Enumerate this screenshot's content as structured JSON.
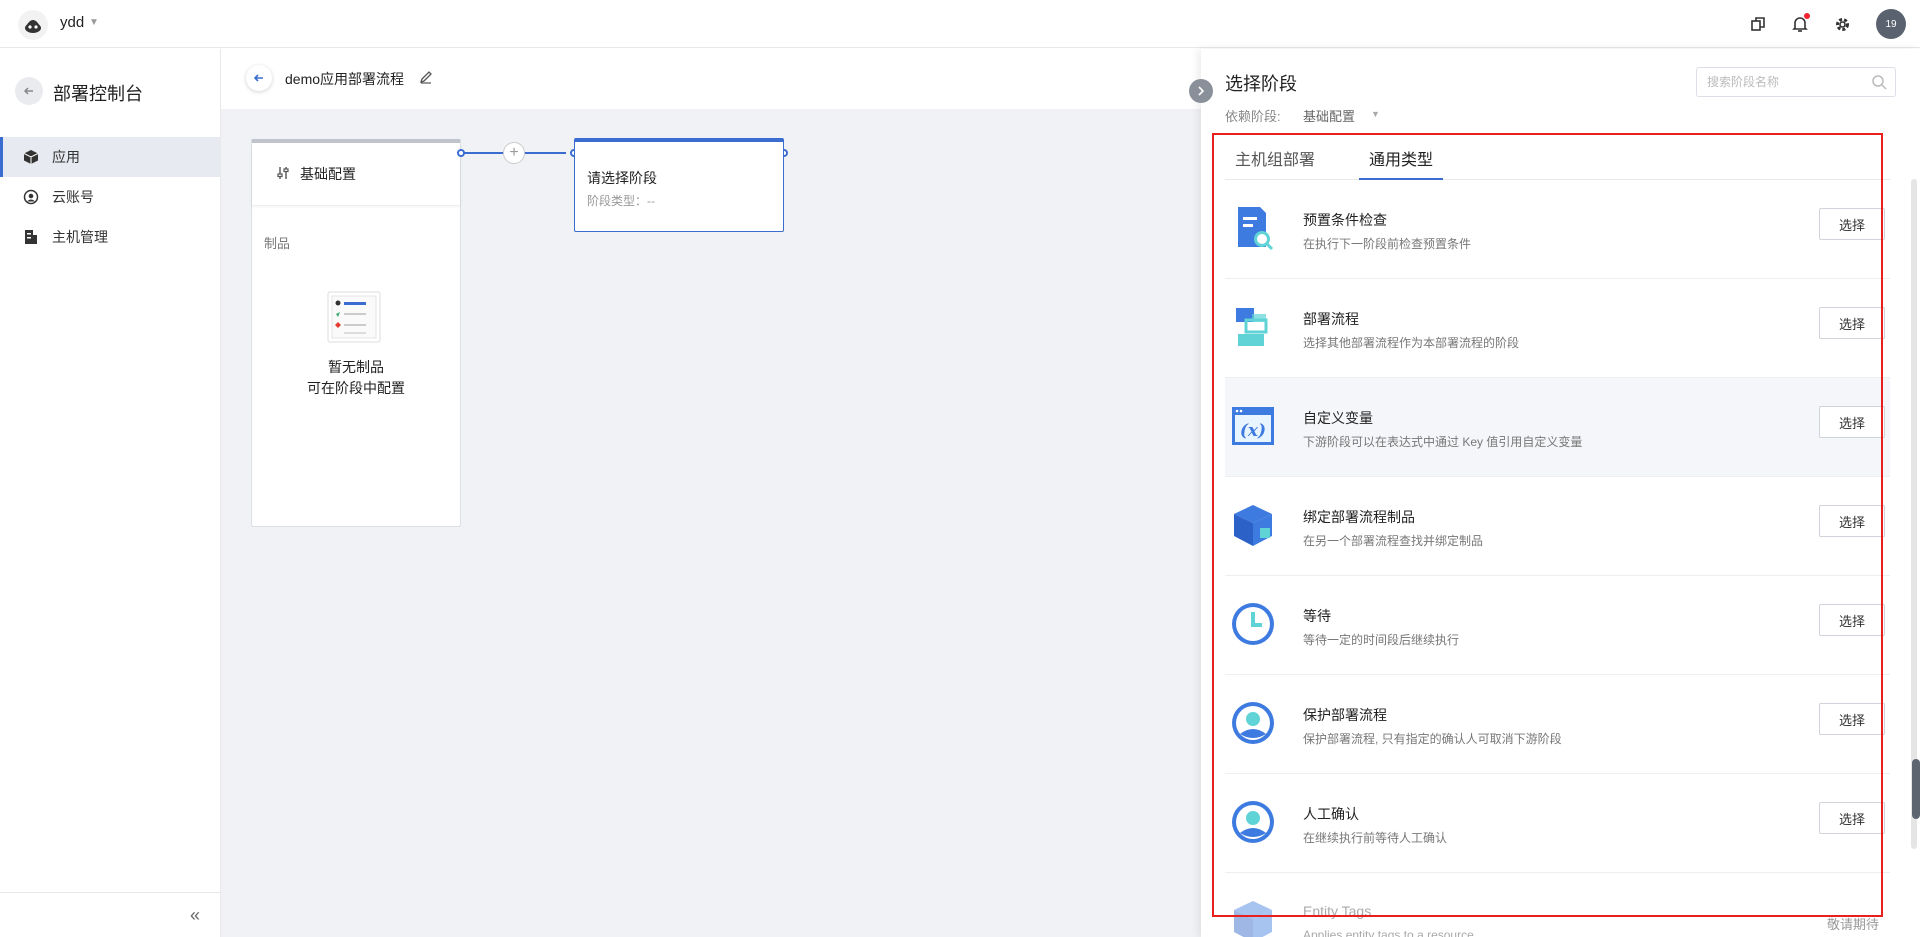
{
  "topbar": {
    "org_name": "ydd",
    "avatar_text": "19"
  },
  "sidebar": {
    "title": "部署控制台",
    "items": [
      {
        "label": "应用",
        "active": true
      },
      {
        "label": "云账号",
        "active": false
      },
      {
        "label": "主机管理",
        "active": false
      }
    ],
    "collapse_glyph": "«"
  },
  "pipeline": {
    "title": "demo应用部署流程",
    "stage": {
      "title": "基础配置",
      "section_label": "制品",
      "empty_line1": "暂无制品",
      "empty_line2": "可在阶段中配置"
    },
    "new_stage": {
      "title": "请选择阶段",
      "type_label": "阶段类型：--"
    }
  },
  "drawer": {
    "title": "选择阶段",
    "search_placeholder": "搜索阶段名称",
    "dependency_label": "依赖阶段:",
    "dependency_value": "基础配置",
    "tabs": [
      {
        "label": "主机组部署",
        "active": false
      },
      {
        "label": "通用类型",
        "active": true
      }
    ],
    "items": [
      {
        "title": "预置条件检查",
        "desc": "在执行下一阶段前检查预置条件",
        "button": "选择",
        "icon": "checklist-search-icon"
      },
      {
        "title": "部署流程",
        "desc": "选择其他部署流程作为本部署流程的阶段",
        "button": "选择",
        "icon": "flow-icon"
      },
      {
        "title": "自定义变量",
        "desc": "下游阶段可以在表达式中通过 Key 值引用自定义变量",
        "button": "选择",
        "icon": "variable-icon"
      },
      {
        "title": "绑定部署流程制品",
        "desc": "在另一个部署流程查找并绑定制品",
        "button": "选择",
        "icon": "cube-icon"
      },
      {
        "title": "等待",
        "desc": "等待一定的时间段后继续执行",
        "button": "选择",
        "icon": "clock-icon"
      },
      {
        "title": "保护部署流程",
        "desc": "保护部署流程, 只有指定的确认人可取消下游阶段",
        "button": "选择",
        "icon": "user-shield-icon"
      },
      {
        "title": "人工确认",
        "desc": "在继续执行前等待人工确认",
        "button": "选择",
        "icon": "user-confirm-icon"
      },
      {
        "title": "Entity Tags",
        "desc": "Applies entity tags to a resource",
        "button": "",
        "icon": "cube-icon"
      }
    ],
    "footer_text": "敬请期待"
  },
  "colors": {
    "accent": "#3b6ccf",
    "highlight": "#e8201d"
  }
}
